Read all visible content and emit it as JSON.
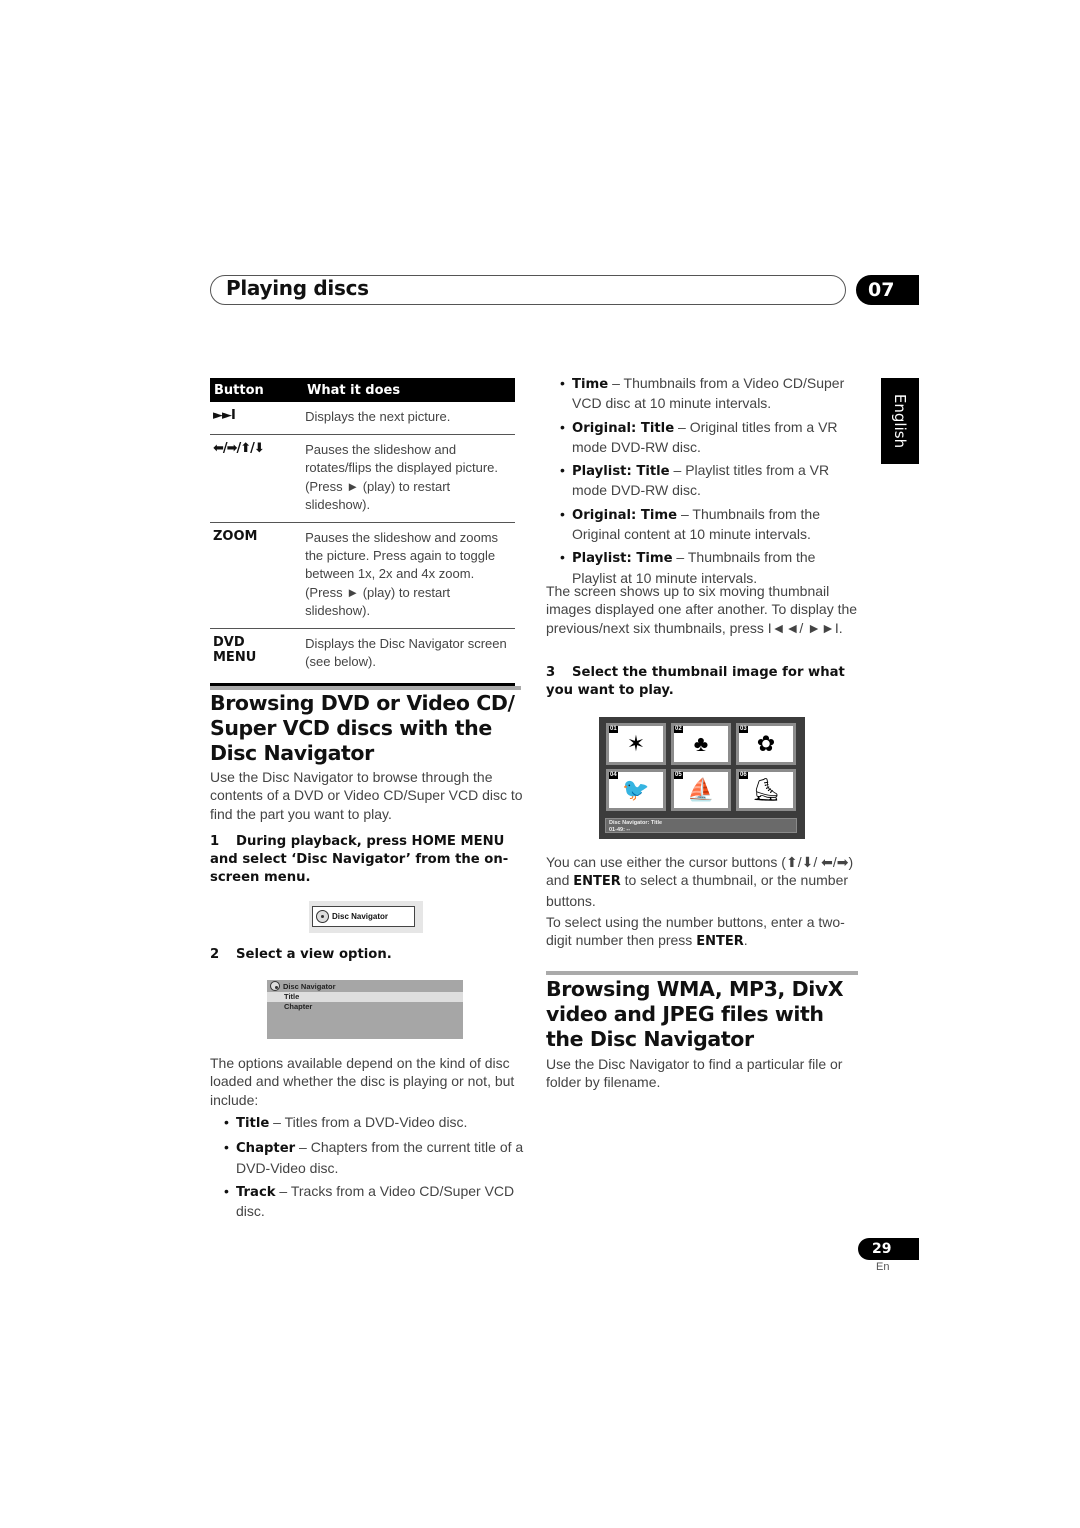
{
  "header": {
    "title": "Playing discs",
    "chapter": "07"
  },
  "side_tab": {
    "language": "English"
  },
  "table": {
    "headers": [
      "Button",
      "What it does"
    ],
    "rows": [
      {
        "button": "►►I",
        "desc": "Displays the next picture."
      },
      {
        "button": "⬅/➡/⬆/⬇",
        "desc": "Pauses the slideshow and rotates/flips the displayed picture. (Press ► (play) to restart slideshow)."
      },
      {
        "button": "ZOOM",
        "desc": "Pauses the slideshow and zooms the picture. Press again to toggle between 1x, 2x and 4x zoom. (Press ► (play) to restart slideshow)."
      },
      {
        "button": "DVD MENU",
        "desc": "Displays the Disc Navigator screen (see below)."
      }
    ]
  },
  "section1": {
    "title": "Browsing DVD or Video CD/ Super VCD discs with the Disc Navigator",
    "intro": "Use the Disc Navigator to browse through the contents of a DVD or Video CD/Super VCD disc to find the part you want to play.",
    "step1": {
      "num": "1",
      "text": "During playback, press HOME MENU and select ‘Disc Navigator’ from the on-screen menu."
    },
    "disc_nav_button": "Disc Navigator",
    "step2": {
      "num": "2",
      "text": "Select a view option."
    },
    "view_menu": {
      "title": "Disc Navigator",
      "items": [
        "Title",
        "Chapter"
      ],
      "selected": "Title"
    },
    "options_para": "The options available depend on the kind of disc loaded and whether the disc is playing or not, but include:",
    "options": [
      {
        "term": "Title",
        "desc": " – Titles from a DVD-Video disc."
      },
      {
        "term": "Chapter",
        "desc": " – Chapters from the current title of a DVD-Video disc."
      },
      {
        "term": "Track",
        "desc": " – Tracks from a Video CD/Super VCD disc."
      },
      {
        "term": "Time",
        "desc": " – Thumbnails from a Video CD/Super VCD disc at 10 minute intervals."
      },
      {
        "term": "Original: Title",
        "desc": " – Original titles from a VR mode DVD-RW disc."
      },
      {
        "term": "Playlist: Title",
        "desc": " – Playlist titles from a VR mode DVD-RW disc."
      },
      {
        "term": "Original: Time",
        "desc": " – Thumbnails from the Original content at 10 minute intervals."
      },
      {
        "term": "Playlist: Time",
        "desc": " – Thumbnails from the Playlist at 10 minute intervals."
      }
    ],
    "screen_para": "The screen shows up to six moving thumbnail images displayed one after another. To display the previous/next six thumbnails, press I◄◄/ ►►I.",
    "step3": {
      "num": "3",
      "text": "Select the thumbnail image for what you want to play."
    },
    "thumb_screen": {
      "thumbs": [
        {
          "num": "01",
          "icon": "leaf-icon",
          "glyph": "✶"
        },
        {
          "num": "02",
          "icon": "tree-icon",
          "glyph": "♣"
        },
        {
          "num": "03",
          "icon": "flower-icon",
          "glyph": "✿"
        },
        {
          "num": "04",
          "icon": "bird-icon",
          "glyph": "🐦"
        },
        {
          "num": "05",
          "icon": "windsurfer-icon",
          "glyph": "⛵"
        },
        {
          "num": "06",
          "icon": "skater-icon",
          "glyph": "⛸"
        }
      ],
      "status_line1": "Disc Navigator: Title",
      "status_line2": "01-49: --"
    },
    "cursor_para_a": "You can use either the cursor buttons (⬆/⬇/ ⬅/➡) and ",
    "cursor_para_enter": "ENTER",
    "cursor_para_b": " to select a thumbnail, or the number buttons.",
    "number_para_a": "To select using the number buttons, enter a two-digit number then press ",
    "number_para_enter": "ENTER",
    "number_para_b": "."
  },
  "section2": {
    "title": "Browsing WMA, MP3, DivX video and JPEG files with the Disc Navigator",
    "intro": "Use the Disc Navigator to find a particular file or folder by filename."
  },
  "footer": {
    "page": "29",
    "lang": "En"
  }
}
